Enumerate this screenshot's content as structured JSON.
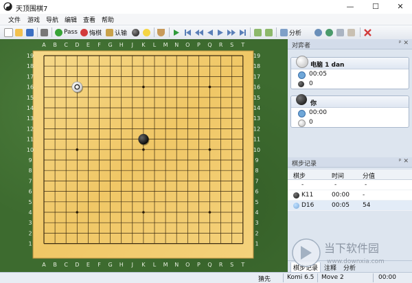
{
  "window": {
    "title": "天顶围棋7",
    "minimize": "—",
    "maximize": "☐",
    "close": "✕"
  },
  "menu": [
    "文件",
    "游戏",
    "导航",
    "编辑",
    "查看",
    "帮助"
  ],
  "toolbar": {
    "pass_label": "Pass",
    "undo_label": "悔棋",
    "resign_label": "认输",
    "analyze_label": "分析"
  },
  "board": {
    "size": 19,
    "columns": [
      "A",
      "B",
      "C",
      "D",
      "E",
      "F",
      "G",
      "H",
      "J",
      "K",
      "L",
      "M",
      "N",
      "O",
      "P",
      "Q",
      "R",
      "S",
      "T"
    ],
    "rows": [
      "19",
      "18",
      "17",
      "16",
      "15",
      "14",
      "13",
      "12",
      "11",
      "10",
      "9",
      "8",
      "7",
      "6",
      "5",
      "4",
      "3",
      "2",
      "1"
    ],
    "stones": [
      {
        "color": "black",
        "point": "K11"
      },
      {
        "color": "white",
        "point": "D16",
        "last_move": true
      }
    ],
    "star_points": [
      "D4",
      "K4",
      "Q4",
      "D10",
      "K10",
      "Q10",
      "D16",
      "K16",
      "Q16"
    ]
  },
  "players_panel": {
    "title": "对弈者",
    "pins": "ᵖ ✕",
    "players": [
      {
        "name": "电脑 1 dan",
        "stone": "white",
        "time": "00:05",
        "captures": "0"
      },
      {
        "name": "你",
        "stone": "black",
        "time": "00:00",
        "captures": "0"
      }
    ]
  },
  "moves_panel": {
    "title": "棋步记录",
    "pins": "ᵖ ✕",
    "headers": [
      "棋步",
      "时间",
      "分值"
    ],
    "rows": [
      {
        "move": "-",
        "time": "-",
        "score": "-"
      },
      {
        "move": "K11",
        "time": "00:00",
        "score": "-"
      },
      {
        "move": "D16",
        "time": "00:05",
        "score": "54"
      }
    ],
    "tabs": [
      "棋步记录",
      "注释",
      "分析"
    ]
  },
  "status": {
    "turn": "猜先",
    "komi": "Komi 6.5",
    "move": "Move 2",
    "clock": "00:00"
  },
  "watermark": {
    "text": "当下软件园",
    "url": "www.downxia.com"
  },
  "colors": {
    "board": "#f2c96b",
    "felt": "#3d6b2f",
    "panel": "#dde5ef"
  }
}
